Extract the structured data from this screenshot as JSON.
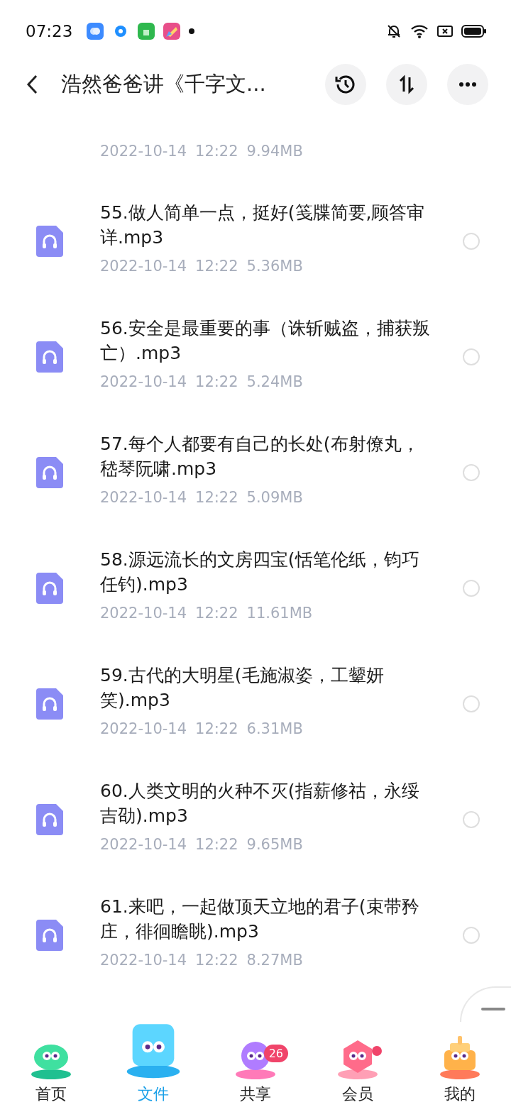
{
  "status_bar": {
    "time": "07:23"
  },
  "header": {
    "title": "浩然爸爸讲《千字文..."
  },
  "files": [
    {
      "date": "2022-10-14",
      "time": "12:22",
      "size": "9.94MB"
    },
    {
      "name": "55.做人简单一点，挺好(笺牒简要,顾答审详.mp3",
      "date": "2022-10-14",
      "time": "12:22",
      "size": "5.36MB",
      "selected": false
    },
    {
      "name": "56.安全是最重要的事（诛斩贼盗，捕获叛亡）.mp3",
      "date": "2022-10-14",
      "time": "12:22",
      "size": "5.24MB",
      "selected": false
    },
    {
      "name": "57.每个人都要有自己的长处(布射僚丸，嵇琴阮啸.mp3",
      "date": "2022-10-14",
      "time": "12:22",
      "size": "5.09MB",
      "selected": false
    },
    {
      "name": "58.源远流长的文房四宝(恬笔伦纸，钧巧任钓).mp3",
      "date": "2022-10-14",
      "time": "12:22",
      "size": "11.61MB",
      "selected": false
    },
    {
      "name": "59.古代的大明星(毛施淑姿，工颦妍笑).mp3",
      "date": "2022-10-14",
      "time": "12:22",
      "size": "6.31MB",
      "selected": false
    },
    {
      "name": "60.人类文明的火种不灭(指薪修祜，永绥吉劭).mp3",
      "date": "2022-10-14",
      "time": "12:22",
      "size": "9.65MB",
      "selected": false
    },
    {
      "name": "61.来吧，一起做顶天立地的君子(束带矜庄，徘徊瞻眺).mp3",
      "date": "2022-10-14",
      "time": "12:22",
      "size": "8.27MB",
      "selected": false
    }
  ],
  "tabs": [
    {
      "label": "首页",
      "selected": false,
      "kind": "home"
    },
    {
      "label": "文件",
      "selected": true,
      "kind": "files"
    },
    {
      "label": "共享",
      "selected": false,
      "kind": "share",
      "badge": "26"
    },
    {
      "label": "会员",
      "selected": false,
      "kind": "vip",
      "dot": true
    },
    {
      "label": "我的",
      "selected": false,
      "kind": "me"
    }
  ]
}
